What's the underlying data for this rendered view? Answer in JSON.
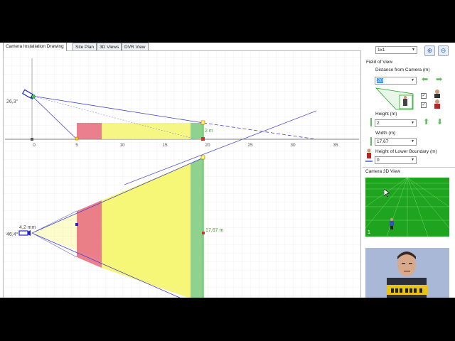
{
  "tabs": [
    {
      "label": "Camera Installation Drawing",
      "active": true
    },
    {
      "label": "Site Plan",
      "active": false
    },
    {
      "label": "3D Views",
      "active": false
    },
    {
      "label": "DVR View",
      "active": false
    }
  ],
  "side_view": {
    "x_ticks": [
      "0",
      "5",
      "10",
      "15",
      "20",
      "25",
      "30",
      "35"
    ],
    "tilt_angle": "26,3°",
    "height_label": "2 m"
  },
  "top_view": {
    "focal_label": "4,2 mm",
    "angle_label": "46,4°",
    "width_label": "17,67 m"
  },
  "panel": {
    "layout_select": "1x1",
    "zoom_in": "⊕",
    "zoom_out": "⊖",
    "field_of_view": "Field of View",
    "distance_label": "Distance from Camera  (m)",
    "distance_value": "20",
    "height_label": "Height (m)",
    "height_value": "2",
    "width_label": "Width (m)",
    "width_value": "17,67",
    "lower_boundary_label": "Height of Lower Boundary (m)",
    "lower_boundary_value": "0",
    "camera_3d_label": "Camera 3D View",
    "view_index": "1"
  },
  "colors": {
    "red_zone": "#e8697a",
    "yellow_zone": "#f5f56e",
    "green_zone": "#8fd18f",
    "camera_blue": "#2222cc",
    "ground_green": "#1fa41f"
  },
  "icons": [
    "zoom-in-icon",
    "zoom-out-icon",
    "arrow-left-icon",
    "arrow-right-icon",
    "arrow-up-icon",
    "arrow-down-icon",
    "camera-icon",
    "person-icon"
  ]
}
